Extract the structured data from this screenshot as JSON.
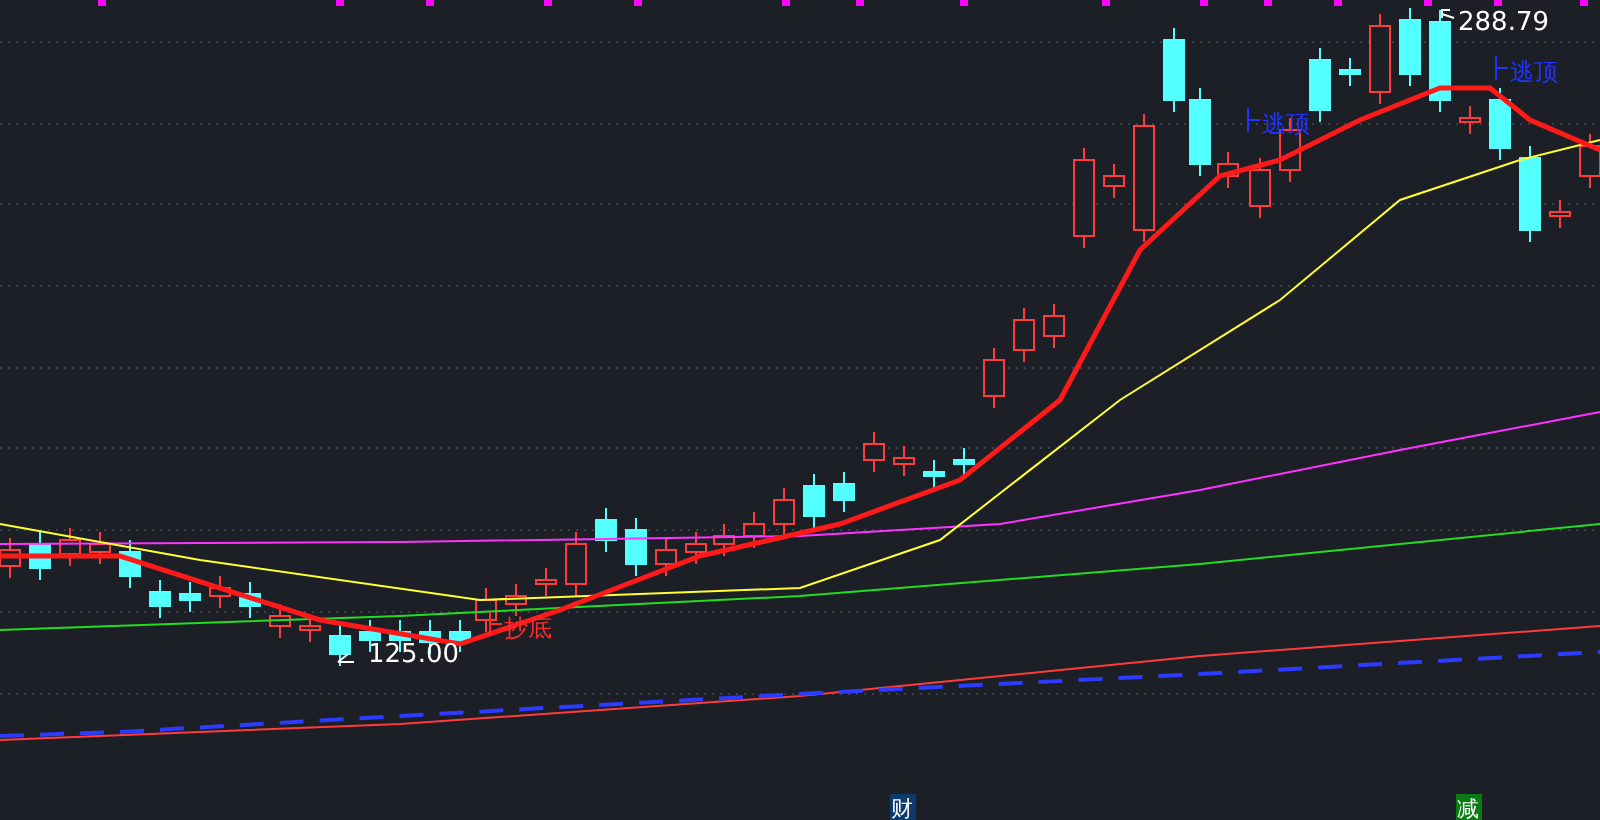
{
  "chart": {
    "price_labels": [
      {
        "kind": "high",
        "text": "288.79"
      },
      {
        "kind": "low",
        "text": "125.00"
      }
    ],
    "signals": [
      {
        "kind": "buy",
        "text": "抄底"
      },
      {
        "kind": "sell",
        "text": "逃顶"
      },
      {
        "kind": "sell",
        "text": "逃顶"
      }
    ]
  },
  "event_markers": [
    {
      "text": "财",
      "color": "#0b3a6b"
    },
    {
      "text": "减",
      "color": "#0a7a12"
    }
  ]
}
